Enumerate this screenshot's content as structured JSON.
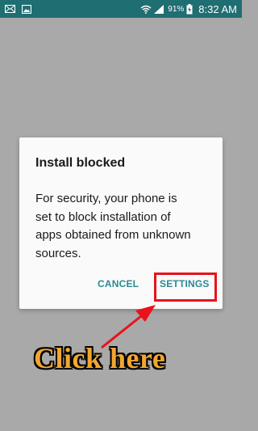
{
  "status_bar": {
    "icons_left": [
      "email-icon",
      "image-icon"
    ],
    "icons_right": [
      "wifi-icon",
      "signal-icon",
      "battery-charging-icon"
    ],
    "battery": "91%",
    "time": "8:32 AM"
  },
  "dialog": {
    "title": "Install blocked",
    "message_lines": [
      "For security, your phone is",
      "set to block installation of",
      "apps obtained from unknown",
      "sources."
    ],
    "cancel_label": "CANCEL",
    "settings_label": "SETTINGS"
  },
  "annotation": {
    "text": "Click here",
    "color": "#e8131b",
    "text_color": "#f2a630"
  },
  "colors": {
    "status_bar": "#1f6e72",
    "scrim": "#a9a9a9",
    "accent": "#2a8a92"
  }
}
